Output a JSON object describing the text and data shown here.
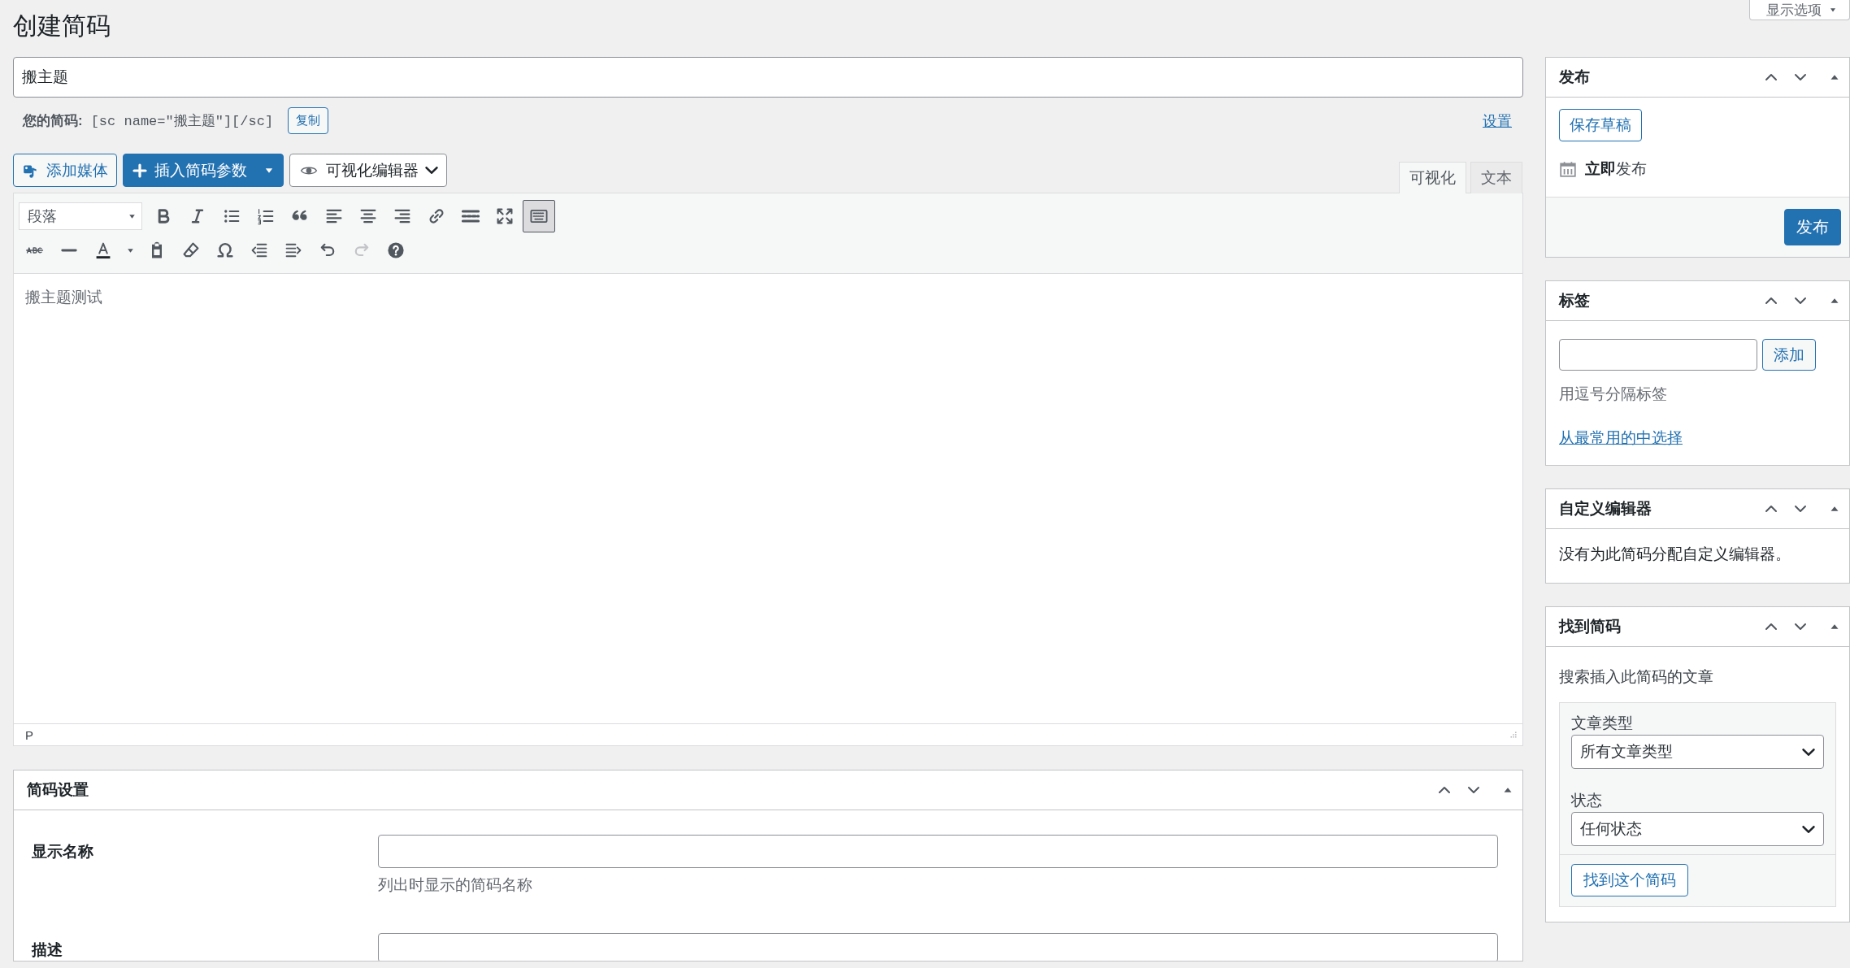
{
  "page_title": "创建简码",
  "screen_options": "显示选项",
  "title_field": {
    "value": "搬主题"
  },
  "shortcode_bar": {
    "label": "您的简码:",
    "code": "[sc name=\"搬主题\"][/sc]",
    "copy_button": "复制",
    "settings_link": "设置"
  },
  "editor": {
    "buttons": [
      {
        "kind": "media",
        "label": "添加媒体"
      },
      {
        "kind": "insert",
        "label": "插入简码参数"
      },
      {
        "kind": "mode",
        "label": "可视化编辑器"
      }
    ],
    "tabs": [
      {
        "label": "可视化",
        "selected": true
      },
      {
        "label": "文本",
        "selected": false
      }
    ],
    "format": "段落",
    "toolbar_toggle_on": true,
    "redo_disabled": true,
    "content": "搬主题测试",
    "path": "P"
  },
  "settings_panel": {
    "title": "简码设置",
    "fields": [
      {
        "kind": "input",
        "label": "显示名称",
        "hint": "列出时显示的简码名称"
      },
      {
        "kind": "textarea",
        "label": "描述"
      }
    ]
  },
  "sidebar": [
    {
      "kind": "publish",
      "title": "发布",
      "save_button": "保存草稿",
      "schedule": "**立即**发布",
      "publish_button": "发布"
    },
    {
      "kind": "tags",
      "title": "标签",
      "add_button": "添加",
      "hint": "用逗号分隔标签",
      "link": "从最常用的中选择"
    },
    {
      "kind": "custom_editor",
      "title": "自定义编辑器",
      "text": "没有为此简码分配自定义编辑器。"
    },
    {
      "kind": "find",
      "title": "找到简码",
      "description": "搜索插入此简码的文章",
      "filters": [
        {
          "label": "文章类型",
          "value": "所有文章类型"
        },
        {
          "label": "状态",
          "value": "任何状态"
        }
      ],
      "button": "找到这个简码"
    }
  ]
}
